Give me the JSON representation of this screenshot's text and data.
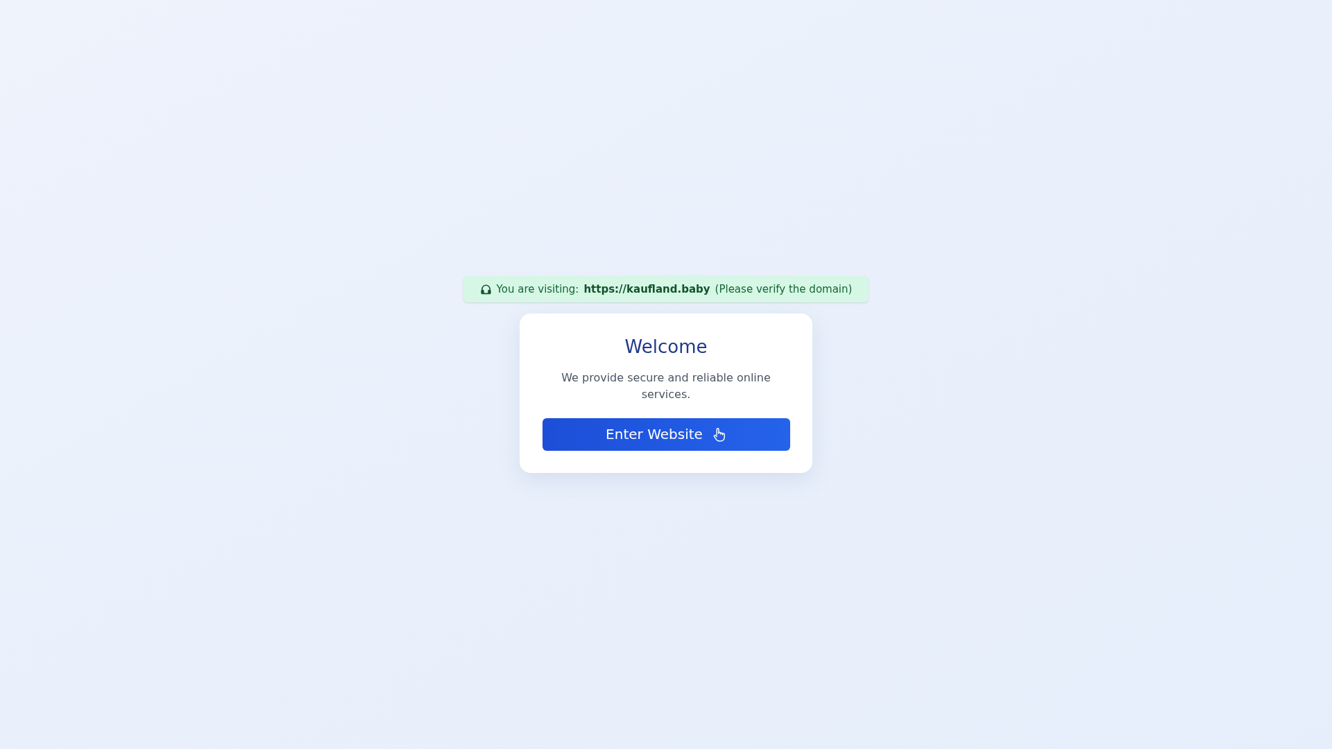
{
  "notice": {
    "prefix": "You are visiting:",
    "domain": "https://kaufland.baby",
    "suffix": "(Please verify the domain)"
  },
  "card": {
    "title": "Welcome",
    "description": "We provide secure and reliable online services.",
    "button": "Enter Website"
  }
}
